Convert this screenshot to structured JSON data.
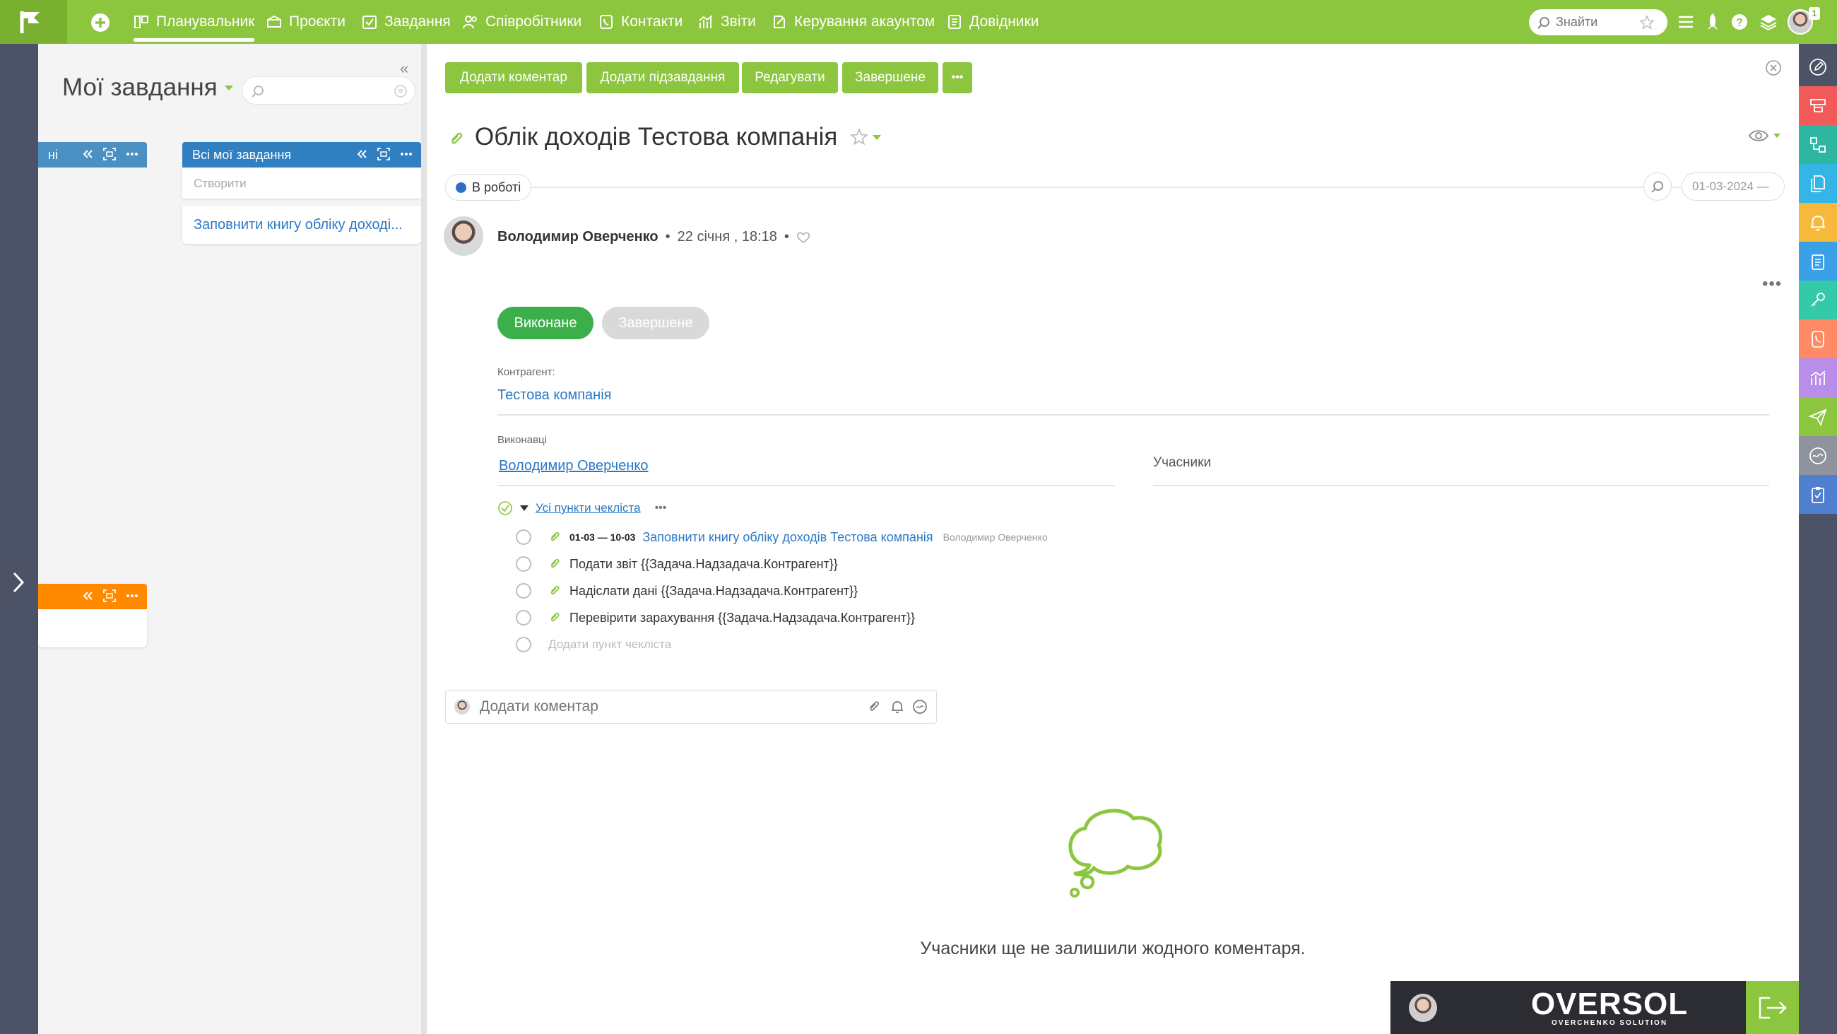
{
  "nav": {
    "items": [
      {
        "label": "Планувальник",
        "icon": "planner-icon",
        "active": true
      },
      {
        "label": "Проєкти",
        "icon": "projects-icon"
      },
      {
        "label": "Завдання",
        "icon": "tasks-icon"
      },
      {
        "label": "Співробітники",
        "icon": "employees-icon"
      },
      {
        "label": "Контакти",
        "icon": "contacts-icon"
      },
      {
        "label": "Звіти",
        "icon": "reports-icon"
      },
      {
        "label": "Керування акаунтом",
        "icon": "account-icon"
      },
      {
        "label": "Довідники",
        "icon": "directories-icon"
      }
    ],
    "search_placeholder": "Знайти",
    "badge": "1",
    "accent": "#8cc63f"
  },
  "planner": {
    "title": "Мої завдання",
    "col_left_label": "ні",
    "col_main": {
      "label": "Всі мої завдання",
      "create_placeholder": "Створити",
      "task": "Заповнити книгу обліку доході..."
    }
  },
  "toolbar": {
    "add_comment": "Додати коментар",
    "add_subtask": "Додати підзавдання",
    "edit": "Редагувати",
    "finished": "Завершене",
    "more": "•••"
  },
  "task": {
    "title": "Облік доходів Тестова компанія",
    "status": "В роботі",
    "status_color": "#2f6ec6",
    "date_range": "01-03-2024 —",
    "author": "Володимир Оверченко",
    "posted": "22 січня , 18:18",
    "btn_done": "Виконане",
    "btn_finished": "Завершене",
    "contractor_label": "Контрагент:",
    "contractor": "Тестова компанія",
    "executors_label": "Виконавці",
    "executor": "Володимир Оверченко",
    "participants_label": "Учасники"
  },
  "checklist": {
    "header": "Усі пункти чекліста",
    "items": [
      {
        "dates": "01-03 — 10-03",
        "text": "Заповнити книгу обліку доходів Тестова компанія",
        "who": "Володимир Оверченко"
      },
      {
        "text": "Подати звіт {{Задача.Надзадача.Контрагент}}"
      },
      {
        "text": "Надіслати дані {{Задача.Надзадача.Контрагент}}"
      },
      {
        "text": "Перевірити зарахування {{Задача.Надзадача.Контрагент}}"
      }
    ],
    "add_placeholder": "Додати пункт чекліста"
  },
  "comment": {
    "placeholder": "Додати коментар",
    "empty_text": "Учасники ще не залишили жодного коментаря."
  },
  "brand": {
    "name": "OVERSOL",
    "sub": "OVERCHENKO SOLUTION"
  },
  "right_bar": [
    {
      "icon": "edit-icon",
      "color": "#4d5366"
    },
    {
      "icon": "boards-icon",
      "color": "#f25a5a"
    },
    {
      "icon": "structure-icon",
      "color": "#2fb6a3"
    },
    {
      "icon": "documents-icon",
      "color": "#33b5e5"
    },
    {
      "icon": "bell-icon",
      "color": "#f6b93b"
    },
    {
      "icon": "clipboard-icon",
      "color": "#3aa0e8"
    },
    {
      "icon": "key-icon",
      "color": "#34c9a8"
    },
    {
      "icon": "phone-icon",
      "color": "#ff8a65"
    },
    {
      "icon": "chart-icon",
      "color": "#b98ee8"
    },
    {
      "icon": "send-icon",
      "color": "#8cc63f"
    },
    {
      "icon": "wave-icon",
      "color": "#8e939e"
    },
    {
      "icon": "checklist-icon",
      "color": "#4f7fd0"
    }
  ]
}
